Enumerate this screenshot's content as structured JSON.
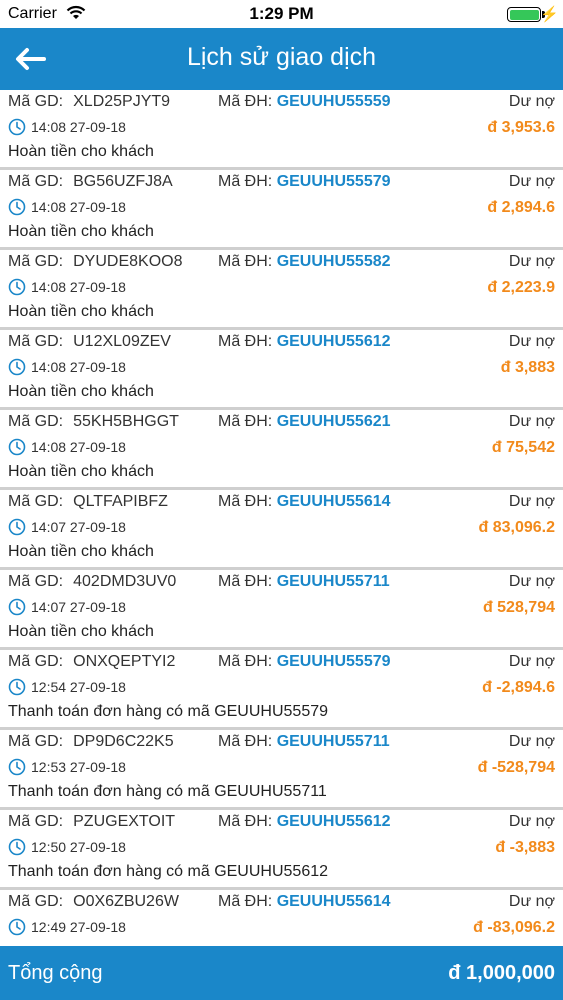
{
  "status_bar": {
    "carrier": "Carrier",
    "time": "1:29 PM",
    "wifi_icon": "wifi-icon",
    "battery_icon": "battery-icon",
    "battery_level_percent": 100,
    "battery_color": "#35c759"
  },
  "header": {
    "title": "Lịch sử giao dịch",
    "back_icon": "arrow-left-icon",
    "background_color": "#1a87c9"
  },
  "labels": {
    "gd": "Mã GD:",
    "dh": "Mã ĐH:"
  },
  "transactions": [
    {
      "gd": "XLD25PJYT9",
      "dh": "GEUUHU55559",
      "kind": "Dư nợ",
      "time": "14:08 27-09-18",
      "amount": "đ 3,953.6",
      "desc": "Hoàn tiền cho khách"
    },
    {
      "gd": "BG56UZFJ8A",
      "dh": "GEUUHU55579",
      "kind": "Dư nợ",
      "time": "14:08 27-09-18",
      "amount": "đ 2,894.6",
      "desc": "Hoàn tiền cho khách"
    },
    {
      "gd": "DYUDE8KOO8",
      "dh": "GEUUHU55582",
      "kind": "Dư nợ",
      "time": "14:08 27-09-18",
      "amount": "đ 2,223.9",
      "desc": "Hoàn tiền cho khách"
    },
    {
      "gd": "U12XL09ZEV",
      "dh": "GEUUHU55612",
      "kind": "Dư nợ",
      "time": "14:08 27-09-18",
      "amount": "đ 3,883",
      "desc": "Hoàn tiền cho khách"
    },
    {
      "gd": "55KH5BHGGT",
      "dh": "GEUUHU55621",
      "kind": "Dư nợ",
      "time": "14:08 27-09-18",
      "amount": "đ 75,542",
      "desc": "Hoàn tiền cho khách"
    },
    {
      "gd": "QLTFAPIBFZ",
      "dh": "GEUUHU55614",
      "kind": "Dư nợ",
      "time": "14:07 27-09-18",
      "amount": "đ 83,096.2",
      "desc": "Hoàn tiền cho khách"
    },
    {
      "gd": "402DMD3UV0",
      "dh": "GEUUHU55711",
      "kind": "Dư nợ",
      "time": "14:07 27-09-18",
      "amount": "đ 528,794",
      "desc": "Hoàn tiền cho khách"
    },
    {
      "gd": "ONXQEPTYI2",
      "dh": "GEUUHU55579",
      "kind": "Dư nợ",
      "time": "12:54 27-09-18",
      "amount": "đ -2,894.6",
      "desc": "Thanh toán đơn hàng có mã GEUUHU55579"
    },
    {
      "gd": "DP9D6C22K5",
      "dh": "GEUUHU55711",
      "kind": "Dư nợ",
      "time": "12:53 27-09-18",
      "amount": "đ -528,794",
      "desc": "Thanh toán đơn hàng có mã GEUUHU55711"
    },
    {
      "gd": "PZUGEXTOIT",
      "dh": "GEUUHU55612",
      "kind": "Dư nợ",
      "time": "12:50 27-09-18",
      "amount": "đ -3,883",
      "desc": "Thanh toán đơn hàng có mã GEUUHU55612"
    },
    {
      "gd": "O0X6ZBU26W",
      "dh": "GEUUHU55614",
      "kind": "Dư nợ",
      "time": "12:49 27-09-18",
      "amount": "đ -83,096.2",
      "desc": ""
    }
  ],
  "footer": {
    "label": "Tổng cộng",
    "total": "đ 1,000,000"
  },
  "colors": {
    "accent": "#1a87c9",
    "amount": "#f28a1b"
  }
}
